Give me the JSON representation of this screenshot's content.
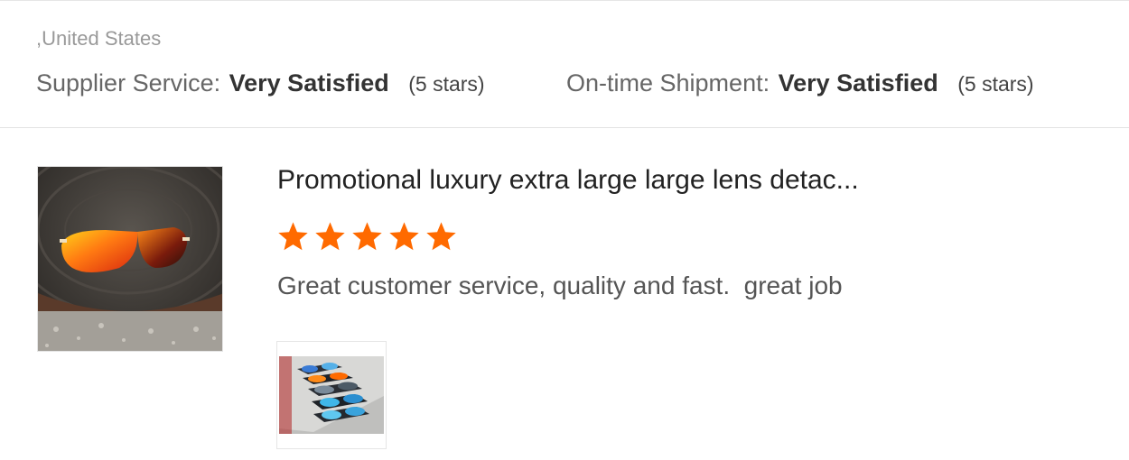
{
  "header": {
    "country": ",United States",
    "supplier_service": {
      "label": "Supplier Service:",
      "value": "Very Satisfied",
      "stars_text": "(5 stars)"
    },
    "ontime_shipment": {
      "label": "On-time Shipment:",
      "value": "Very Satisfied",
      "stars_text": "(5 stars)"
    }
  },
  "review": {
    "product_title": "Promotional luxury extra large large lens detac...",
    "rating": 5,
    "rating_max": 5,
    "star_color": "#ff6a00",
    "text": "Great customer service, quality and fast.  great job",
    "product_image_icon": "sunglasses-product-photo",
    "review_photo_icon": "sunglasses-collection-photo"
  }
}
